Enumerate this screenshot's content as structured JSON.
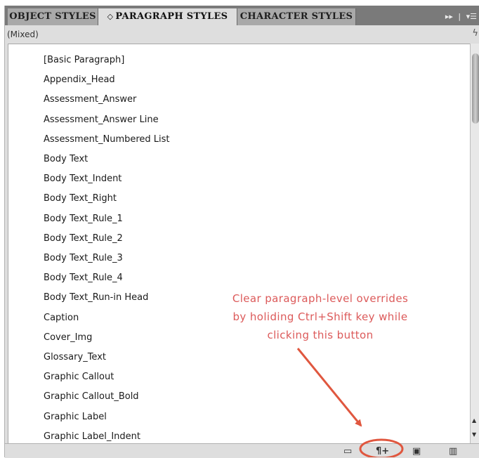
{
  "tabs": [
    {
      "label": "OBJECT STYLES"
    },
    {
      "label": "PARAGRAPH STYLES",
      "active": true
    },
    {
      "label": "CHARACTER STYLES"
    }
  ],
  "tab_toolbar": {
    "expand": "▸▸",
    "menu": "▾☰"
  },
  "mixed_label": "(Mixed)",
  "styles": [
    {
      "label": "[Basic Paragraph]"
    },
    {
      "label": "Appendix_Head"
    },
    {
      "label": "Assessment_Answer"
    },
    {
      "label": "Assessment_Answer Line"
    },
    {
      "label": "Assessment_Numbered List"
    },
    {
      "label": "Body Text"
    },
    {
      "label": "Body Text_Indent"
    },
    {
      "label": "Body Text_Right"
    },
    {
      "label": "Body Text_Rule_1"
    },
    {
      "label": "Body Text_Rule_2"
    },
    {
      "label": "Body Text_Rule_3"
    },
    {
      "label": "Body Text_Rule_4"
    },
    {
      "label": "Body Text_Run-in Head"
    },
    {
      "label": "Caption"
    },
    {
      "label": "Cover_Img"
    },
    {
      "label": "Glossary_Text"
    },
    {
      "label": "Graphic Callout"
    },
    {
      "label": "Graphic Callout_Bold"
    },
    {
      "label": "Graphic Label"
    },
    {
      "label": "Graphic Label_Indent"
    }
  ],
  "annotation": {
    "lines": [
      "Clear paragraph-level overrides",
      "by holiding Ctrl+Shift key while",
      "clicking this button"
    ],
    "color": "#dc5a5a"
  },
  "toolbar_icons": {
    "folder": "folder-icon",
    "clear_overrides": "clear-overrides-icon",
    "new_style": "new-style-icon",
    "delete": "trash-icon"
  }
}
